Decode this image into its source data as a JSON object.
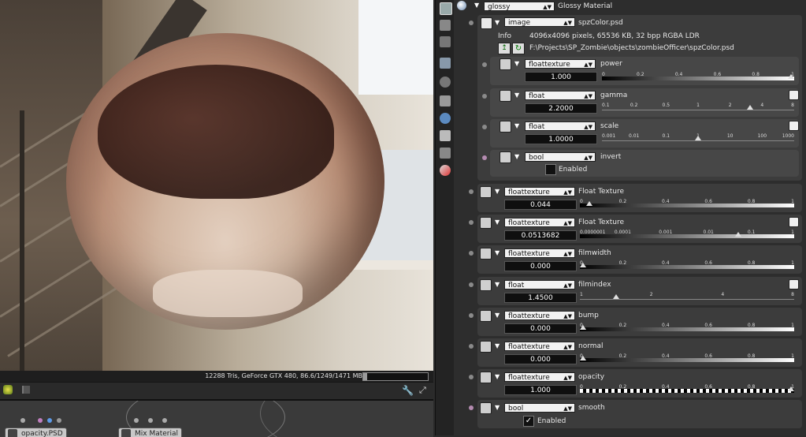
{
  "viewport": {
    "status_text": "12288 Tris, GeForce GTX 480, 86.6/1249/1471 MB",
    "memory_usage_fraction": 0.06,
    "graph_nodes": [
      {
        "label": "opacity.PSD"
      },
      {
        "label": "Mix Material"
      }
    ]
  },
  "header": {
    "material_type": "glossy",
    "material_title": "Glossy Material"
  },
  "diffuse": {
    "type": "image",
    "file": "spzColor.psd",
    "info_label": "Info",
    "info_value": "4096x4096 pixels, 65536 KB, 32 bpp RGBA LDR",
    "path": "F:\\Projects\\SP_Zombie\\objects\\zombieOfficer\\spzColor.psd",
    "power": {
      "type": "floattexture",
      "name": "power",
      "value": "1.000",
      "ticks": [
        "0",
        "0.2",
        "0.4",
        "0.6",
        "0.8",
        "1"
      ],
      "fraction": 1.0
    },
    "gamma": {
      "type": "float",
      "name": "gamma",
      "value": "2.2000",
      "ticks": [
        "0.1",
        "0.2",
        "0.5",
        "1",
        "2",
        "4",
        "8"
      ],
      "fraction": 0.77
    },
    "scale": {
      "type": "float",
      "name": "scale",
      "value": "1.0000",
      "ticks": [
        "0.001",
        "0.01",
        "0.1",
        "1",
        "10",
        "100",
        "1000"
      ],
      "fraction": 0.5
    },
    "invert": {
      "type": "bool",
      "name": "invert",
      "checkbox_label": "Enabled",
      "checked": false
    }
  },
  "params": [
    {
      "type": "floattexture",
      "name": "Float Texture",
      "value": "0.044",
      "ticks": [
        "0",
        "0.2",
        "0.4",
        "0.6",
        "0.8",
        "1"
      ],
      "fraction": 0.044,
      "style": "grad",
      "curve": false
    },
    {
      "type": "floattexture",
      "name": "Float Texture",
      "value": "0.0513682",
      "ticks": [
        "0.0000001",
        "0.0001",
        "0.001",
        "0.01",
        "0.1",
        "1"
      ],
      "fraction": 0.74,
      "style": "grad",
      "curve": true
    },
    {
      "type": "floattexture",
      "name": "filmwidth",
      "value": "0.000",
      "ticks": [
        "0",
        "0.2",
        "0.4",
        "0.6",
        "0.8",
        "1"
      ],
      "fraction": 0.0,
      "style": "grad",
      "curve": false
    },
    {
      "type": "float",
      "name": "filmindex",
      "value": "1.4500",
      "ticks": [
        "1",
        "2",
        "4",
        "8"
      ],
      "fraction": 0.17,
      "style": "plain",
      "curve": true
    },
    {
      "type": "floattexture",
      "name": "bump",
      "value": "0.000",
      "ticks": [
        "0",
        "0.2",
        "0.4",
        "0.6",
        "0.8",
        "1"
      ],
      "fraction": 0.0,
      "style": "grad",
      "curve": false
    },
    {
      "type": "floattexture",
      "name": "normal",
      "value": "0.000",
      "ticks": [
        "0",
        "0.2",
        "0.4",
        "0.6",
        "0.8",
        "1"
      ],
      "fraction": 0.0,
      "style": "grad",
      "curve": false
    },
    {
      "type": "floattexture",
      "name": "opacity",
      "value": "1.000",
      "ticks": [
        "0",
        "0.2",
        "0.4",
        "0.6",
        "0.8",
        "1"
      ],
      "fraction": 1.0,
      "style": "checker",
      "curve": false
    }
  ],
  "smooth": {
    "type": "bool",
    "name": "smooth",
    "checkbox_label": "Enabled",
    "checked": true
  },
  "colors": {
    "panel_bg": "#2d2d2d",
    "card_bg": "#3c3c3c",
    "input_bg": "#0f0f0f"
  }
}
